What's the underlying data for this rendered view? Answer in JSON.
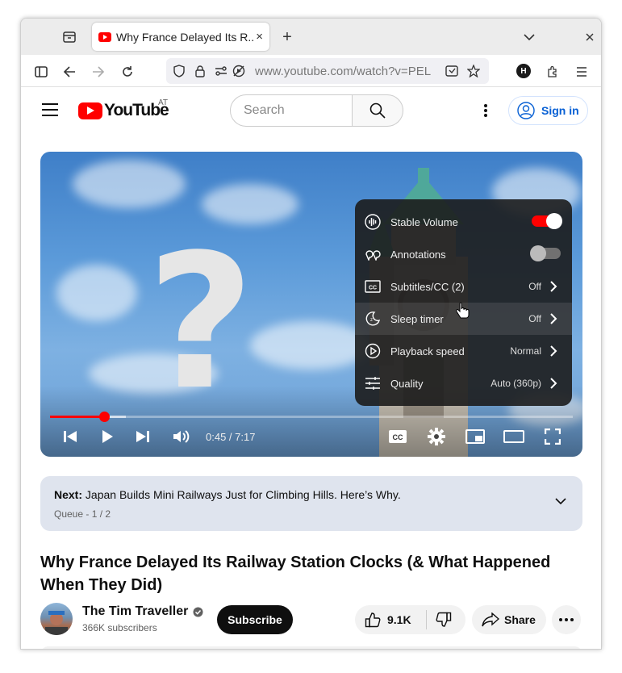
{
  "browser": {
    "tab_title": "Why France Delayed Its R...",
    "tab_close": "×",
    "new_tab": "+",
    "url_host": "www.youtube.com",
    "url_path": "/watch?v=PEL",
    "profile_letter": "H"
  },
  "header": {
    "logo_text": "YouTube",
    "country_code": "AT",
    "search_placeholder": "Search",
    "signin_label": "Sign in"
  },
  "player": {
    "time": "0:45 / 7:17",
    "progress_played_fraction": 0.1,
    "settings_menu": [
      {
        "label": "Stable Volume",
        "value": "",
        "icon": "stable-volume-icon",
        "type": "toggle",
        "on": true
      },
      {
        "label": "Annotations",
        "value": "",
        "icon": "annotations-icon",
        "type": "toggle",
        "on": false
      },
      {
        "label": "Subtitles/CC (2)",
        "value": "Off",
        "icon": "subtitles-icon",
        "type": "submenu"
      },
      {
        "label": "Sleep timer",
        "value": "Off",
        "icon": "sleep-timer-icon",
        "type": "submenu"
      },
      {
        "label": "Playback speed",
        "value": "Normal",
        "icon": "playback-speed-icon",
        "type": "submenu"
      },
      {
        "label": "Quality",
        "value": "Auto (360p)",
        "icon": "quality-icon",
        "type": "submenu"
      }
    ],
    "cc_label": "CC"
  },
  "next_up": {
    "prefix": "Next:",
    "title": "Japan Builds Mini Railways Just for Climbing Hills. Here’s Why.",
    "queue": "Queue - 1 / 2"
  },
  "video": {
    "title": "Why France Delayed Its Railway Station Clocks (& What Happened When They Did)",
    "channel_name": "The Tim Traveller",
    "subscribers": "366K subscribers",
    "subscribe_label": "Subscribe",
    "likes": "9.1K",
    "share_label": "Share"
  },
  "colors": {
    "brand_red": "#ff0000",
    "link_blue": "#065fd4",
    "next_box_bg": "#dfe4ee"
  }
}
